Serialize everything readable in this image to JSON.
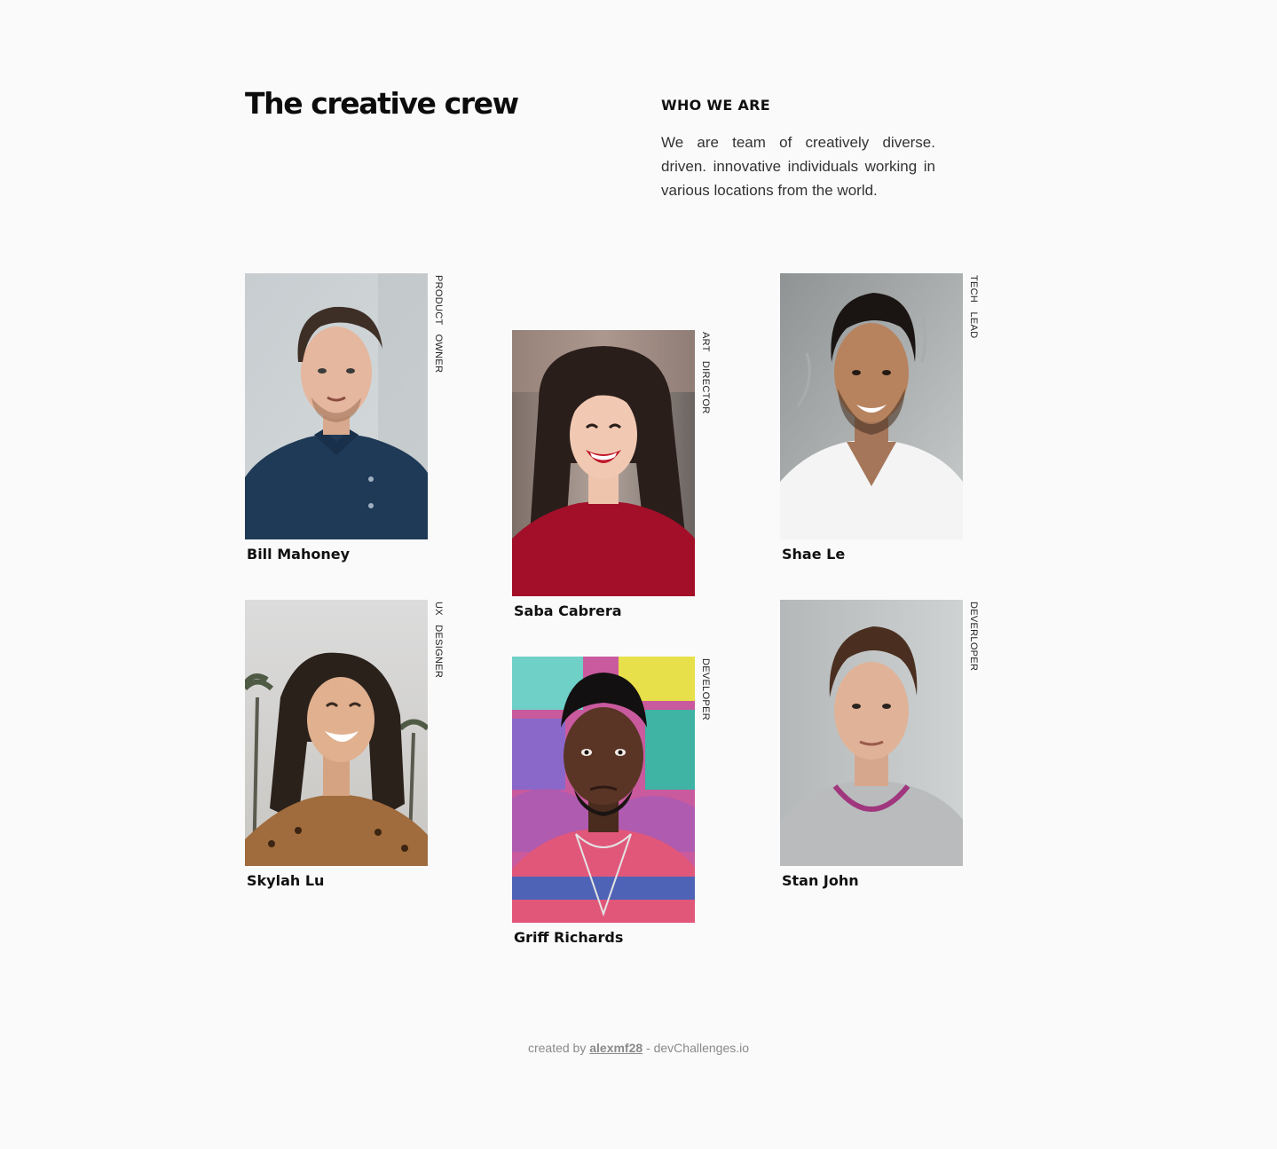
{
  "header": {
    "title": "The creative crew",
    "who_heading": "WHO WE ARE",
    "who_text": "We are team of creatively diverse. driven. innovative individuals working in various locations from the world."
  },
  "team": [
    {
      "name": "Bill Mahoney",
      "role": "PRODUCT OWNER"
    },
    {
      "name": "Saba Cabrera",
      "role": "ART DIRECTOR"
    },
    {
      "name": "Shae Le",
      "role": "TECH LEAD"
    },
    {
      "name": "Skylah Lu",
      "role": "UX DESIGNER"
    },
    {
      "name": "Griff Richards",
      "role": "DEVELOPER"
    },
    {
      "name": "Stan John",
      "role": "DEVERLOPER"
    }
  ],
  "footer": {
    "prefix": "created by",
    "author": "alexmf28",
    "suffix": "- devChallenges.io"
  },
  "colors": {
    "background": "#fafafa",
    "text": "#111111",
    "footer_text": "#8a8a8a"
  }
}
